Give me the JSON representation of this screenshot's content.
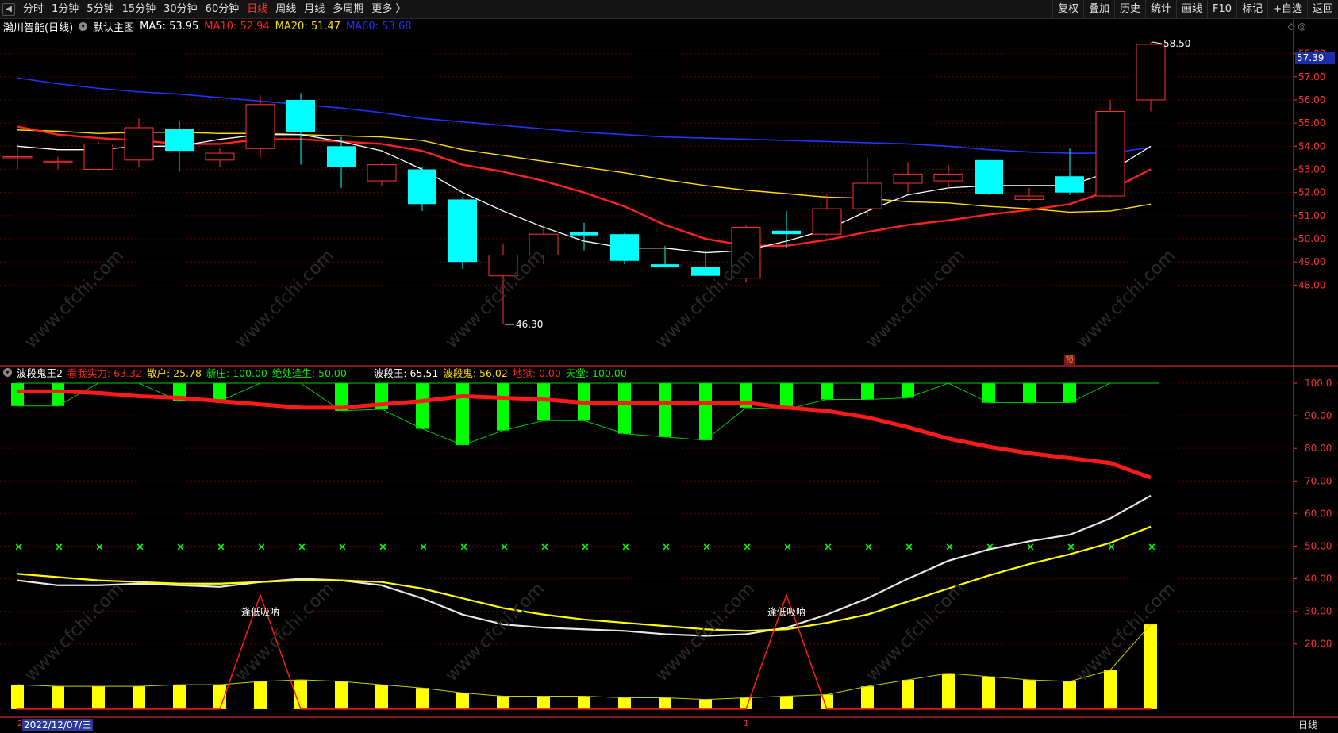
{
  "toolbar": {
    "back_icon": "◀",
    "periods": [
      "分时",
      "1分钟",
      "5分钟",
      "15分钟",
      "30分钟",
      "60分钟",
      "日线",
      "周线",
      "月线",
      "多周期",
      "更多 〉"
    ],
    "active_period": "日线",
    "tools": [
      "复权",
      "叠加",
      "历史",
      "统计",
      "画线",
      "F10",
      "标记",
      "+自选",
      "返回"
    ]
  },
  "main_legend": {
    "title": "瀚川智能(日线)",
    "template": "默认主图",
    "ma": [
      {
        "label": "MA5: 53.95",
        "color": "#ffffff"
      },
      {
        "label": "MA10: 52.94",
        "color": "#ff2222"
      },
      {
        "label": "MA20: 51.47",
        "color": "#ffdd00"
      },
      {
        "label": "MA60: 53.68",
        "color": "#2233ff"
      }
    ],
    "corner_icons": "◇ ◎"
  },
  "indicator_legend": {
    "name": "波段鬼王2",
    "items": [
      {
        "label": "看我实力: 63.32",
        "color": "#ff2222"
      },
      {
        "label": "散户: 25.78",
        "color": "#ffdd00"
      },
      {
        "label": "新庄: 100.00",
        "color": "#00ee00"
      },
      {
        "label": "绝处逢生: 50.00",
        "color": "#00ee00"
      },
      {
        "label": "波段王: 65.51",
        "color": "#ffffff"
      },
      {
        "label": "波段鬼: 56.02",
        "color": "#ffdd00"
      },
      {
        "label": "地狱: 0.00",
        "color": "#ff2222"
      },
      {
        "label": "天堂: 100.00",
        "color": "#00ee00"
      }
    ]
  },
  "status": {
    "date": "2022/12/07/三",
    "left_mark": "2",
    "mid_mark": "1",
    "period_label": "日线",
    "pred_badge": "预",
    "current_price": "57.39"
  },
  "chart_data": {
    "type": "candlestick",
    "stock": "瀚川智能",
    "price_axis": {
      "range": [
        46.3,
        58.5
      ],
      "ticks": [
        "58.00",
        "57.00",
        "56.00",
        "55.00",
        "54.00",
        "53.00",
        "52.00",
        "51.00",
        "50.00",
        "49.00",
        "48.00"
      ]
    },
    "indicator_axis": {
      "ticks": [
        "100.0",
        "90.00",
        "80.00",
        "70.00",
        "60.00",
        "50.00",
        "40.00",
        "30.00",
        "20.00"
      ]
    },
    "annotations": {
      "high": "58.50",
      "low": "46.30",
      "signal_text": "逢低吸呐"
    },
    "colors": {
      "up": "#ff3333",
      "down": "#00ffff",
      "ma5": "#ffffff",
      "ma10": "#ff2222",
      "ma20": "#ffdd00",
      "ma60": "#2233ff",
      "axis": "#ff3333",
      "grid": "#5a0000",
      "green": "#00ff00",
      "yellow": "#ffff00"
    },
    "candles": [
      {
        "o": 53.55,
        "h": 54.1,
        "l": 53.0,
        "c": 53.55
      },
      {
        "o": 53.35,
        "h": 53.55,
        "l": 53.0,
        "c": 53.35
      },
      {
        "o": 53.0,
        "h": 54.2,
        "l": 52.9,
        "c": 54.1
      },
      {
        "o": 53.4,
        "h": 55.2,
        "l": 53.1,
        "c": 54.8
      },
      {
        "o": 54.75,
        "h": 55.1,
        "l": 52.9,
        "c": 53.8
      },
      {
        "o": 53.4,
        "h": 53.9,
        "l": 53.1,
        "c": 53.7
      },
      {
        "o": 53.9,
        "h": 56.2,
        "l": 53.5,
        "c": 55.8
      },
      {
        "o": 56.0,
        "h": 56.3,
        "l": 53.2,
        "c": 54.6
      },
      {
        "o": 54.0,
        "h": 54.4,
        "l": 52.2,
        "c": 53.1
      },
      {
        "o": 52.5,
        "h": 53.3,
        "l": 52.3,
        "c": 53.2
      },
      {
        "o": 53.0,
        "h": 53.1,
        "l": 51.2,
        "c": 51.5
      },
      {
        "o": 51.7,
        "h": 51.8,
        "l": 48.7,
        "c": 49.0
      },
      {
        "o": 48.4,
        "h": 49.8,
        "l": 46.3,
        "c": 49.3
      },
      {
        "o": 49.3,
        "h": 50.6,
        "l": 48.9,
        "c": 50.2
      },
      {
        "o": 50.3,
        "h": 50.7,
        "l": 49.5,
        "c": 50.15
      },
      {
        "o": 50.2,
        "h": 50.25,
        "l": 48.9,
        "c": 49.05
      },
      {
        "o": 48.9,
        "h": 49.7,
        "l": 48.8,
        "c": 48.8
      },
      {
        "o": 48.8,
        "h": 49.5,
        "l": 48.4,
        "c": 48.4
      },
      {
        "o": 48.3,
        "h": 50.6,
        "l": 48.1,
        "c": 50.5
      },
      {
        "o": 50.35,
        "h": 51.2,
        "l": 49.6,
        "c": 50.2
      },
      {
        "o": 50.2,
        "h": 51.9,
        "l": 50.1,
        "c": 51.3
      },
      {
        "o": 51.3,
        "h": 53.5,
        "l": 51.0,
        "c": 52.4
      },
      {
        "o": 52.4,
        "h": 53.3,
        "l": 52.0,
        "c": 52.8
      },
      {
        "o": 52.5,
        "h": 53.2,
        "l": 52.2,
        "c": 52.8
      },
      {
        "o": 53.4,
        "h": 53.4,
        "l": 51.9,
        "c": 51.95
      },
      {
        "o": 51.7,
        "h": 52.2,
        "l": 51.6,
        "c": 51.85
      },
      {
        "o": 52.7,
        "h": 53.9,
        "l": 51.9,
        "c": 52.0
      },
      {
        "o": 51.85,
        "h": 56.0,
        "l": 51.8,
        "c": 55.5
      },
      {
        "o": 56.0,
        "h": 58.5,
        "l": 55.5,
        "c": 58.4
      }
    ],
    "ma5": [
      54.0,
      53.85,
      53.85,
      54.0,
      54.0,
      54.3,
      54.5,
      54.5,
      54.2,
      53.8,
      53.0,
      52.0,
      51.2,
      50.5,
      49.9,
      49.6,
      49.6,
      49.4,
      49.5,
      49.9,
      50.4,
      51.2,
      51.9,
      52.2,
      52.3,
      52.3,
      52.3,
      52.9,
      54.0
    ],
    "ma10": [
      54.85,
      54.5,
      54.35,
      54.25,
      54.1,
      54.1,
      54.3,
      54.3,
      54.2,
      54.1,
      53.8,
      53.2,
      52.9,
      52.5,
      52.0,
      51.4,
      50.6,
      50.0,
      49.7,
      49.7,
      49.95,
      50.3,
      50.6,
      50.8,
      51.05,
      51.25,
      51.5,
      52.1,
      53.0
    ],
    "ma20": [
      54.7,
      54.65,
      54.55,
      54.6,
      54.6,
      54.55,
      54.55,
      54.5,
      54.45,
      54.4,
      54.25,
      53.85,
      53.6,
      53.35,
      53.1,
      52.85,
      52.55,
      52.3,
      52.1,
      51.95,
      51.8,
      51.75,
      51.6,
      51.55,
      51.4,
      51.3,
      51.15,
      51.2,
      51.5
    ],
    "ma60": [
      56.95,
      56.7,
      56.5,
      56.35,
      56.25,
      56.1,
      55.95,
      55.8,
      55.65,
      55.45,
      55.2,
      55.05,
      54.9,
      54.75,
      54.6,
      54.5,
      54.4,
      54.35,
      54.3,
      54.25,
      54.2,
      54.15,
      54.1,
      54.0,
      53.85,
      53.75,
      53.7,
      53.7,
      53.95
    ],
    "ind_red": [
      97.5,
      97.5,
      97,
      96,
      95.5,
      94.5,
      93.5,
      92.5,
      92.5,
      93.5,
      94.5,
      96,
      95.5,
      95,
      94,
      94,
      94,
      94,
      94,
      92.5,
      91.5,
      89.5,
      86.5,
      83,
      80.5,
      78.5,
      77,
      75.5,
      71,
      63.5
    ],
    "ind_green": [
      93,
      93,
      100,
      100,
      94.5,
      94.5,
      100,
      100,
      91.5,
      92,
      86,
      81,
      85.5,
      88.5,
      88.5,
      84.5,
      83.5,
      82.5,
      92.5,
      92,
      95,
      95,
      95.5,
      100,
      94,
      94,
      94,
      100
    ],
    "ind_white": [
      39.5,
      38,
      38,
      38.5,
      38,
      37.5,
      39,
      40,
      39.5,
      38,
      34,
      29,
      26,
      25,
      24.5,
      24,
      23,
      22.5,
      23,
      25,
      29,
      34,
      40,
      45.5,
      49,
      51.5,
      53.5,
      58.5,
      65.5
    ],
    "ind_yellow": [
      41.5,
      40.5,
      39.5,
      39,
      38.5,
      38.5,
      39,
      39.5,
      39.5,
      39,
      37,
      34,
      31,
      29,
      27.5,
      26.5,
      25.5,
      24.5,
      24,
      24.5,
      26.5,
      29,
      33,
      37,
      41,
      44.5,
      47.5,
      51,
      56
    ],
    "ind_signal": [
      0,
      0,
      0,
      0,
      0,
      0,
      35,
      0,
      0,
      0,
      0,
      0,
      0,
      0,
      0,
      0,
      0,
      0,
      0,
      35,
      0,
      0,
      0,
      0,
      0,
      0,
      0,
      0,
      0
    ],
    "ind_bars": [
      7.5,
      7,
      7,
      7,
      7.5,
      7.5,
      8.5,
      9,
      8.5,
      7.5,
      6.5,
      5,
      4,
      4,
      4,
      3.5,
      3.5,
      3,
      3.5,
      4,
      4.5,
      7,
      9,
      11,
      10,
      9,
      8.5,
      12,
      26
    ],
    "ind_bar_line": [
      7.5,
      7,
      7,
      7,
      7.5,
      7.5,
      8.5,
      9,
      8.5,
      7.5,
      6.5,
      5,
      4,
      4,
      4,
      3.5,
      3.5,
      3,
      3.5,
      4,
      4.5,
      7,
      9,
      11,
      10,
      9,
      8.5,
      12,
      26
    ],
    "ind_x_markers": 50
  }
}
